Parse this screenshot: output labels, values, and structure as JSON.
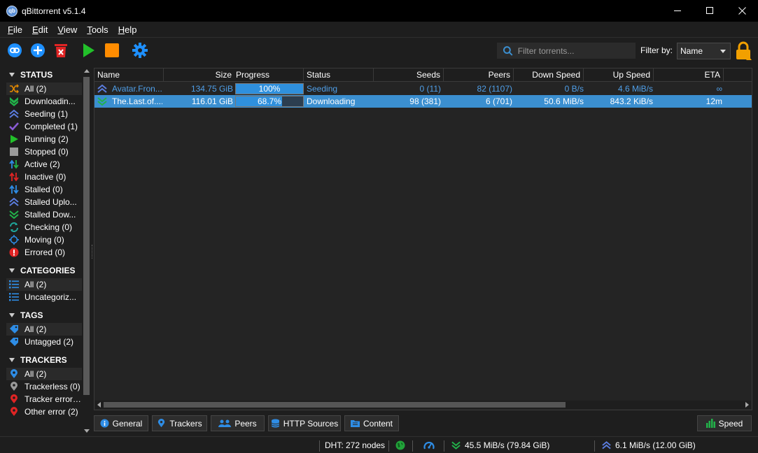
{
  "window": {
    "title": "qBittorrent v5.1.4",
    "minimize_glyph": "—",
    "maximize_glyph": "☐",
    "close_glyph": "✕"
  },
  "menu": [
    {
      "label": "File",
      "u": "F",
      "rest": "ile"
    },
    {
      "label": "Edit",
      "u": "E",
      "rest": "dit"
    },
    {
      "label": "View",
      "u": "V",
      "rest": "iew"
    },
    {
      "label": "Tools",
      "u": "T",
      "rest": "ools"
    },
    {
      "label": "Help",
      "u": "H",
      "rest": "elp"
    }
  ],
  "toolbar": {
    "search_placeholder": "Filter torrents...",
    "filter_label": "Filter by:",
    "filter_value": "Name",
    "colors": {
      "blue": "#1e90ff",
      "red": "#e02424",
      "green": "#22c02a",
      "orange": "#ff8c00",
      "lock": "#f2a000"
    }
  },
  "sidebar": {
    "status_title": "STATUS",
    "status": [
      {
        "label": "All (2)",
        "icon": "shuffle-icon",
        "selected": true
      },
      {
        "label": "Downloadin...",
        "icon": "download-icon"
      },
      {
        "label": "Seeding (1)",
        "icon": "seeding-icon"
      },
      {
        "label": "Completed (1)",
        "icon": "check-icon"
      },
      {
        "label": "Running (2)",
        "icon": "play-icon"
      },
      {
        "label": "Stopped (0)",
        "icon": "stop-icon"
      },
      {
        "label": "Active (2)",
        "icon": "active-arrows-icon"
      },
      {
        "label": "Inactive (0)",
        "icon": "inactive-arrows-icon"
      },
      {
        "label": "Stalled (0)",
        "icon": "stalled-arrows-icon"
      },
      {
        "label": "Stalled Uplo...",
        "icon": "stalled-upload-icon"
      },
      {
        "label": "Stalled Dow...",
        "icon": "stalled-download-icon"
      },
      {
        "label": "Checking (0)",
        "icon": "checking-icon"
      },
      {
        "label": "Moving (0)",
        "icon": "moving-icon"
      },
      {
        "label": "Errored (0)",
        "icon": "error-icon"
      }
    ],
    "categories_title": "CATEGORIES",
    "categories": [
      {
        "label": "All (2)",
        "selected": true
      },
      {
        "label": "Uncategoriz..."
      }
    ],
    "tags_title": "TAGS",
    "tags": [
      {
        "label": "All (2)",
        "selected": true
      },
      {
        "label": "Untagged (2)"
      }
    ],
    "trackers_title": "TRACKERS",
    "trackers": [
      {
        "label": "All (2)",
        "selected": true,
        "color": "#2e8de6"
      },
      {
        "label": "Trackerless (0)",
        "color": "#9a9a9a"
      },
      {
        "label": "Tracker error ...",
        "color": "#e02424"
      },
      {
        "label": "Other error (2)",
        "color": "#e02424"
      }
    ]
  },
  "table": {
    "columns": [
      "Name",
      "Size",
      "Progress",
      "Status",
      "Seeds",
      "Peers",
      "Down Speed",
      "Up Speed",
      "ETA"
    ],
    "rows": [
      {
        "name": "Avatar.Fron...",
        "size": "134.75 GiB",
        "progress": 1.0,
        "progress_label": "100%",
        "status": "Seeding",
        "seeds": "0 (11)",
        "peers": "82 (1107)",
        "down": "0 B/s",
        "up": "4.6 MiB/s",
        "eta": "∞",
        "state": "seeding",
        "selected": false
      },
      {
        "name": "The.Last.of....",
        "size": "116.01 GiB",
        "progress": 0.687,
        "progress_label": "68.7%",
        "status": "Downloading",
        "seeds": "98 (381)",
        "peers": "6 (701)",
        "down": "50.6 MiB/s",
        "up": "843.2 KiB/s",
        "eta": "12m",
        "state": "downloading",
        "selected": true
      }
    ]
  },
  "tabs": [
    "General",
    "Trackers",
    "Peers",
    "HTTP Sources",
    "Content"
  ],
  "speed_button": "Speed",
  "statusbar": {
    "dht": "DHT: 272 nodes",
    "download": "45.5 MiB/s (79.84 GiB)",
    "upload": "6.1 MiB/s (12.00 GiB)"
  }
}
